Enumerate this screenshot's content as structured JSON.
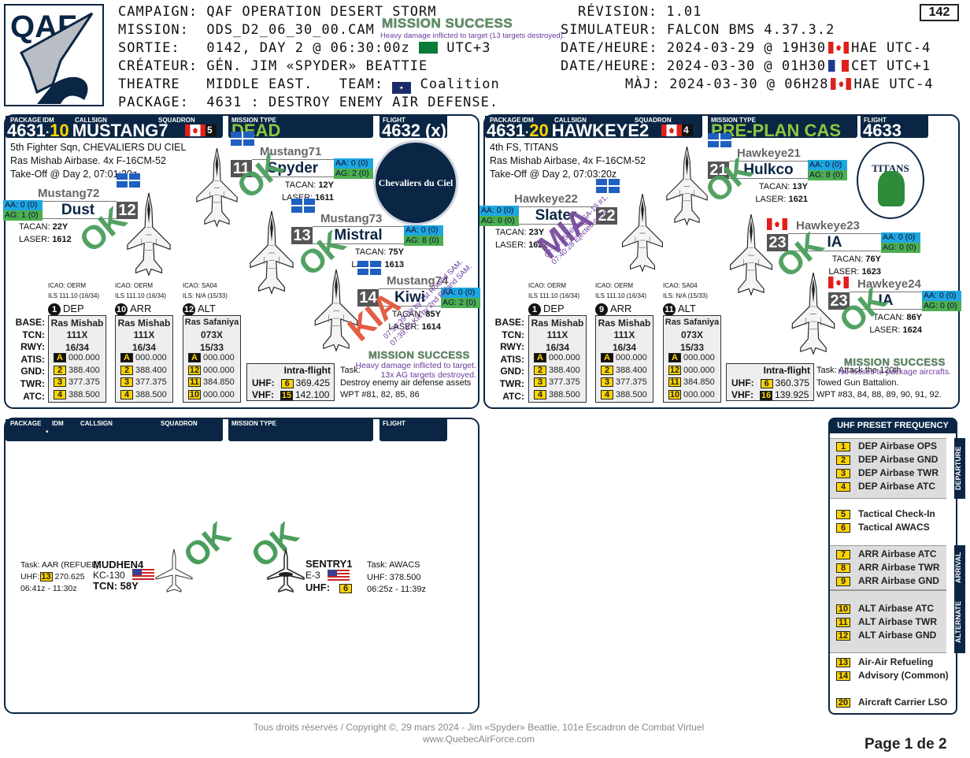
{
  "header": {
    "campaign_label": "CAMPAIGN:",
    "campaign": "QAF OPERATION DESERT STORM",
    "mission_label": "MISSION:",
    "mission": "ODS_D2_06_30_00.CAM",
    "sortie_label": "SORTIE:",
    "sortie": "0142, DAY 2 @ 06:30:00z",
    "sortie_tz": "UTC+3",
    "creator_label": "CRÉATEUR:",
    "creator": "GÉN. JIM «SPYDER» BEATTIE",
    "theatre_label": "THEATRE",
    "theatre": "MIDDLE EAST.",
    "team_label": "TEAM:",
    "team": "Coalition",
    "package_label": "PACKAGE:",
    "package": "4631 : DESTROY ENEMY AIR DEFENSE.",
    "revision_label": "RÉVISION:",
    "revision": "1.01",
    "simulator_label": "SIMULATEUR:",
    "simulator": "FALCON BMS 4.37.3.2",
    "dates": [
      {
        "label": "DATE/HEURE:",
        "value": "2024-03-29 @ 19H30",
        "flag": "canada",
        "tz": "HAE UTC-4"
      },
      {
        "label": "DATE/HEURE:",
        "value": "2024-03-30 @ 01H30",
        "flag": "france",
        "tz": "CET UTC+1"
      },
      {
        "label": "MÀJ:",
        "value": "2024-03-30 @ 06H28",
        "flag": "canada",
        "tz": "HAE UTC-4"
      }
    ],
    "page_box": "142",
    "result_title": "MISSION SUCCESS",
    "result_detail": "Heavy damage inflicted to target (13 targets destroyed).",
    "logo": "QAF"
  },
  "labels": {
    "package": "PACKAGE",
    "idm": "IDM",
    "callsign": "CALLSIGN",
    "squadron": "SQUADRON",
    "mission_type": "MISSION TYPE",
    "flight": "FLIGHT",
    "intra": "Intra-flight",
    "uhf": "UHF:",
    "vhf": "VHF:",
    "tacan": "TACAN: ",
    "laser": "LASER: ",
    "rows": [
      "BASE:",
      "TCN:",
      "RWY:",
      "ATIS:",
      "GND:",
      "TWR:",
      "ATC:"
    ]
  },
  "colors": {
    "navy": "#0b2644",
    "ok": "#4a9e5c",
    "kia": "#e4553c",
    "mia": "#7a4f9c",
    "aa": "#1ea7e1",
    "ag": "#4caf50",
    "preset": "#ffd400",
    "mission_type": "#8dc63f"
  },
  "flights": [
    {
      "package": "4631",
      "idm": "10",
      "callsign": "MUSTANG7",
      "squadron_flag": "canada",
      "squadron_num": "5",
      "mission_type": "DEAD",
      "flight": "4632 (x)",
      "info": [
        "5th Fighter Sqn, CHEVALIERS DU CIEL",
        "Ras Mishab Airbase. 4x F-16CM-52",
        "Take-Off @ Day 2, 07:01:20z"
      ],
      "logo": "Chevaliers du Ciel",
      "pilots": [
        {
          "name": "Mustang71",
          "num": "11",
          "callsign": "Spyder",
          "aa": "AA: 0 (0)",
          "ag": "AG: 2 (0)",
          "tacan": "12Y",
          "laser": "1611",
          "flag": "quebec",
          "status": "OK",
          "notes": []
        },
        {
          "name": "Mustang72",
          "num": "12",
          "callsign": "Dust",
          "aa": "AA: 0 (0)",
          "ag": "AG: 1 (0)",
          "tacan": "22Y",
          "laser": "1612",
          "flag": "quebec",
          "status": "OK",
          "notes": []
        },
        {
          "name": "Mustang73",
          "num": "13",
          "callsign": "Mistral",
          "aa": "AA: 0 (0)",
          "ag": "AG: 8 (0)",
          "tacan": "75Y",
          "laser": "1613",
          "flag": "quebec",
          "status": "OK",
          "notes": []
        },
        {
          "name": "Mustang74",
          "num": "14",
          "callsign": "Kiwi",
          "aa": "AA: 0 (0)",
          "ag": "AG: 2 (0)",
          "tacan": "85Y",
          "laser": "1614",
          "flag": "quebec",
          "status": "KIA",
          "notes": [
            "07:39:39 Hit by 1st Roland SAM.",
            "07:39:45 Kill by 2nd Roland SAM."
          ]
        }
      ],
      "airbases": [
        {
          "num": "1",
          "type": "DEP",
          "icao": "ICAO: OERM",
          "ils": "ILS 111.10 (16/34)",
          "base": "Ras Mishab",
          "tcn": "111X",
          "rwy": "16/34",
          "freqs": [
            {
              "ch": "A",
              "val": "000.000",
              "dark": true
            },
            {
              "ch": "2",
              "val": "388.400"
            },
            {
              "ch": "3",
              "val": "377.375"
            },
            {
              "ch": "4",
              "val": "388.500"
            }
          ]
        },
        {
          "num": "10",
          "type": "ARR",
          "icao": "ICAO: OERM",
          "ils": "ILS 111.10 (16/34)",
          "base": "Ras Mishab",
          "tcn": "111X",
          "rwy": "16/34",
          "freqs": [
            {
              "ch": "A",
              "val": "000.000",
              "dark": true
            },
            {
              "ch": "2",
              "val": "388.400"
            },
            {
              "ch": "3",
              "val": "377.375"
            },
            {
              "ch": "4",
              "val": "388.500"
            }
          ]
        },
        {
          "num": "12",
          "type": "ALT",
          "icao": "ICAO: SA04",
          "ils": "ILS: N/A (15/33)",
          "base": "Ras Safaniya",
          "tcn": "073X",
          "rwy": "15/33",
          "freqs": [
            {
              "ch": "A",
              "val": "000.000",
              "dark": true
            },
            {
              "ch": "12",
              "val": "000.000"
            },
            {
              "ch": "11",
              "val": "384.850"
            },
            {
              "ch": "10",
              "val": "000.000"
            }
          ]
        }
      ],
      "intra": {
        "uhf_ch": "6",
        "uhf": "369.425",
        "vhf_ch": "15",
        "vhf": "142.100"
      },
      "task": [
        "Task:",
        "Destroy enemy air defense assets",
        "WPT #81, 82, 85, 86"
      ],
      "result_title": "MISSION SUCCESS",
      "result_detail": [
        "Heavy damage inflicted to target.",
        "13x AG targets destroyed."
      ]
    },
    {
      "package": "4631",
      "idm": "20",
      "callsign": "HAWKEYE2",
      "squadron_flag": "canada",
      "squadron_num": "4",
      "mission_type": "PRE-PLAN CAS",
      "flight": "4633",
      "info": [
        "4th FS, TITANS",
        "Ras Mishab Airbase, 4x F-16CM-52",
        "Take-Off @ Day 2, 07:03:20z"
      ],
      "logo": "TITANS",
      "pilots": [
        {
          "name": "Hawkeye21",
          "num": "21",
          "callsign": "Hulkco",
          "aa": "AA: 0 (0)",
          "ag": "AG: 8 (0)",
          "tacan": "13Y",
          "laser": "1621",
          "flag": "quebec",
          "status": "OK",
          "notes": []
        },
        {
          "name": "Hawkeye22",
          "num": "22",
          "callsign": "Slater",
          "aa": "AA: 0 (0)",
          "ag": "AG: 0 (0)",
          "tacan": "23Y",
          "laser": "1622",
          "flag": "quebec",
          "status": "MIA",
          "notes": [
            "07:40:25 Hit by SA-13 #1.",
            "07:40:28 Ejected crew."
          ]
        },
        {
          "name": "Hawkeye23",
          "num": "23",
          "callsign": "IA",
          "aa": "AA: 0 (0)",
          "ag": "AG: 0 (0)",
          "tacan": "76Y",
          "laser": "1623",
          "flag": "canada",
          "status": "OK",
          "notes": []
        },
        {
          "name": "Hawkeye24",
          "num": "23",
          "callsign": "IA",
          "aa": "AA: 0 (0)",
          "ag": "AG: 0 (0)",
          "tacan": "86Y",
          "laser": "1624",
          "flag": "canada",
          "status": "OK",
          "notes": []
        }
      ],
      "airbases": [
        {
          "num": "1",
          "type": "DEP",
          "icao": "ICAO: OERM",
          "ils": "ILS 111.10 (16/34)",
          "base": "Ras Mishab",
          "tcn": "111X",
          "rwy": "16/34",
          "freqs": [
            {
              "ch": "A",
              "val": "000.000",
              "dark": true
            },
            {
              "ch": "2",
              "val": "388.400"
            },
            {
              "ch": "3",
              "val": "377.375"
            },
            {
              "ch": "4",
              "val": "388.500"
            }
          ]
        },
        {
          "num": "9",
          "type": "ARR",
          "icao": "ICAO: OERM",
          "ils": "ILS 111.10 (16/34)",
          "base": "Ras Mishab",
          "tcn": "111X",
          "rwy": "16/34",
          "freqs": [
            {
              "ch": "A",
              "val": "000.000",
              "dark": true
            },
            {
              "ch": "2",
              "val": "388.400"
            },
            {
              "ch": "3",
              "val": "377.375"
            },
            {
              "ch": "4",
              "val": "388.500"
            }
          ]
        },
        {
          "num": "11",
          "type": "ALT",
          "icao": "ICAO: SA04",
          "ils": "ILS: N/A (15/33)",
          "base": "Ras Safaniya",
          "tcn": "073X",
          "rwy": "15/33",
          "freqs": [
            {
              "ch": "A",
              "val": "000.000",
              "dark": true
            },
            {
              "ch": "12",
              "val": "000.000"
            },
            {
              "ch": "11",
              "val": "384.850"
            },
            {
              "ch": "10",
              "val": "000.000"
            }
          ]
        }
      ],
      "intra": {
        "uhf_ch": "6",
        "uhf": "360.375",
        "vhf_ch": "16",
        "vhf": "139.925"
      },
      "task": [
        "Task: Attack the 120th",
        "Towed Gun Battalion.",
        "WPT #83, 84, 88, 89, 90, 91, 92."
      ],
      "result_title": "MISSION SUCCESS",
      "result_detail": [
        "No losses to package aircrafts."
      ]
    }
  ],
  "support": {
    "idm_dot": "•",
    "tanker": {
      "task": "Task: AAR (REFUEL)",
      "uhf_label": "UHF:",
      "uhf_ch": "13",
      "uhf": "270.625",
      "time": "06:41z - 11:30z",
      "callsign": "MUDHEN4",
      "type": "KC-130",
      "tcn": "TCN: 58Y",
      "flag": "usa",
      "status": "OK"
    },
    "awacs": {
      "callsign": "SENTRY1",
      "type": "E-3",
      "uhf_label": "UHF:",
      "uhf_ch": "6",
      "task": "Task: AWACS",
      "uhf": "UHF: 378.500",
      "time": "06:25z - 11:39z",
      "flag": "usa",
      "status": "OK"
    }
  },
  "legend": {
    "title": "UHF PRESET FREQUENCY",
    "groups": [
      "DEPARTURE",
      "ARRIVAL",
      "ALTERNATE"
    ],
    "items": [
      {
        "ch": "1",
        "label": "DEP Airbase OPS"
      },
      {
        "ch": "2",
        "label": "DEP Airbase GND"
      },
      {
        "ch": "3",
        "label": "DEP Airbase TWR"
      },
      {
        "ch": "4",
        "label": "DEP Airbase ATC"
      },
      {
        "ch": "5",
        "label": "Tactical Check-In"
      },
      {
        "ch": "6",
        "label": "Tactical AWACS"
      },
      {
        "ch": "7",
        "label": "ARR Airbase ATC"
      },
      {
        "ch": "8",
        "label": "ARR Airbase TWR"
      },
      {
        "ch": "9",
        "label": "ARR Airbase GND"
      },
      {
        "ch": "10",
        "label": "ALT Airbase ATC"
      },
      {
        "ch": "11",
        "label": "ALT Airbase TWR"
      },
      {
        "ch": "12",
        "label": "ALT Airbase GND"
      },
      {
        "ch": "13",
        "label": "Air-Air Refueling"
      },
      {
        "ch": "14",
        "label": "Advisory (Common)"
      },
      {
        "ch": "20",
        "label": "Aircraft Carrier LSO"
      }
    ]
  },
  "footer": {
    "copyright": "Tous droits réservés / Copyright ©, 29 mars 2024 - Jim «Spyder» Beattie, 101e Escadron de Combat Virtuel",
    "website": "www.QuebecAirForce.com",
    "page": "Page 1 de 2"
  }
}
